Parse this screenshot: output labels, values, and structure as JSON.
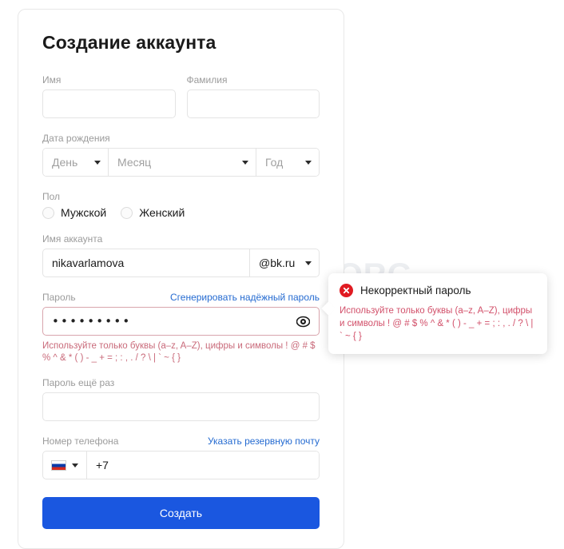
{
  "watermark": "KAK-SDELAT.ORG",
  "form": {
    "title": "Создание аккаунта",
    "first_name": {
      "label": "Имя",
      "value": "",
      "placeholder": ""
    },
    "last_name": {
      "label": "Фамилия",
      "value": "",
      "placeholder": ""
    },
    "birth_date": {
      "label": "Дата рождения",
      "day": "День",
      "month": "Месяц",
      "year": "Год"
    },
    "gender": {
      "label": "Пол",
      "options": [
        {
          "label": "Мужской",
          "selected": false
        },
        {
          "label": "Женский",
          "selected": false
        }
      ]
    },
    "account_name": {
      "label": "Имя аккаунта",
      "value": "nikavarlamova",
      "domain": "@bk.ru"
    },
    "password": {
      "label": "Пароль",
      "generate_link": "Сгенерировать надёжный пароль",
      "value": "•••••••••",
      "error": "Используйте только буквы (a–z, A–Z), цифры и символы ! @ # $ % ^ & * ( ) - _ + = ; : , . / ? \\ | ` ~ { }"
    },
    "password_repeat": {
      "label": "Пароль ещё раз",
      "value": ""
    },
    "phone": {
      "label": "Номер телефона",
      "backup_email_link": "Указать резервную почту",
      "country": "RU",
      "value": "+7"
    },
    "submit_label": "Создать"
  },
  "tooltip": {
    "title": "Некорректный пароль",
    "body": "Используйте только буквы (a–z, A–Z), цифры и символы ! @ # $ % ^ & * ( ) - _ + = ; : , . / ? \\ | ` ~ { }"
  },
  "colors": {
    "accent": "#1a57e0",
    "link": "#256bd1",
    "error_red": "#e01b22",
    "error_text": "#c96a7a",
    "error_border": "#d9a5ad"
  }
}
